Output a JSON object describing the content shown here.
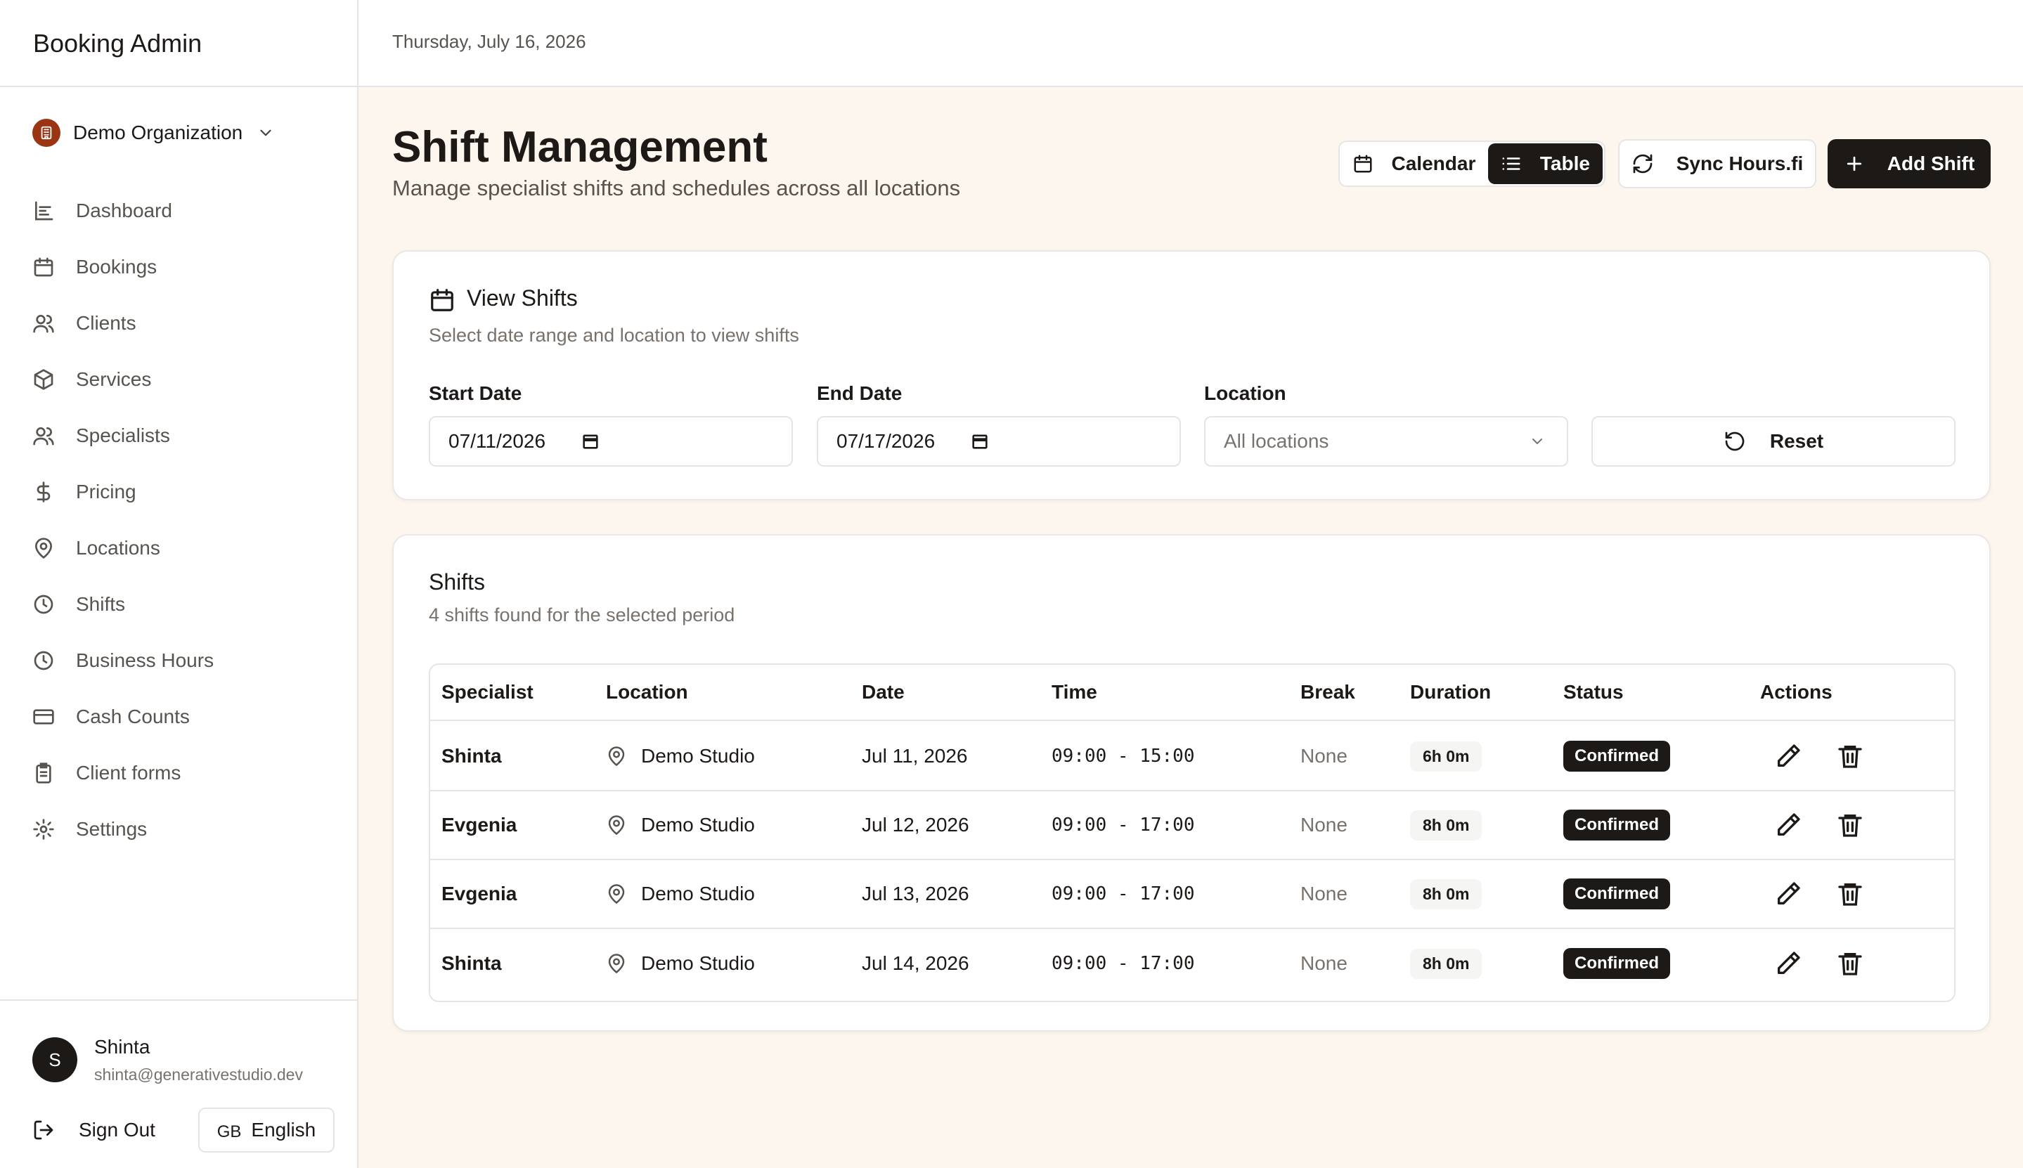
{
  "app": {
    "title": "Booking Admin"
  },
  "org": {
    "name": "Demo Organization"
  },
  "nav": [
    {
      "label": "Dashboard",
      "icon": "chart-icon"
    },
    {
      "label": "Bookings",
      "icon": "calendar-icon"
    },
    {
      "label": "Clients",
      "icon": "users-icon"
    },
    {
      "label": "Services",
      "icon": "package-icon"
    },
    {
      "label": "Specialists",
      "icon": "users-icon"
    },
    {
      "label": "Pricing",
      "icon": "dollar-icon"
    },
    {
      "label": "Locations",
      "icon": "map-pin-icon"
    },
    {
      "label": "Shifts",
      "icon": "clock-icon"
    },
    {
      "label": "Business Hours",
      "icon": "clock-icon"
    },
    {
      "label": "Cash Counts",
      "icon": "credit-card-icon"
    },
    {
      "label": "Client forms",
      "icon": "clipboard-icon"
    },
    {
      "label": "Settings",
      "icon": "gear-icon"
    }
  ],
  "user": {
    "initial": "S",
    "name": "Shinta",
    "email": "shinta@generativestudio.dev"
  },
  "footer": {
    "sign_out": "Sign Out",
    "lang_flag": "GB",
    "lang_label": "English"
  },
  "topbar": {
    "date": "Thursday, July 16, 2026"
  },
  "header": {
    "title": "Shift Management",
    "subtitle": "Manage specialist shifts and schedules across all locations",
    "view_calendar": "Calendar",
    "view_table": "Table",
    "active_view": "Table",
    "sync_label": "Sync Hours.fi",
    "add_label": "Add Shift"
  },
  "filters": {
    "title": "View Shifts",
    "subtitle": "Select date range and location to view shifts",
    "start_label": "Start Date",
    "start_value": "07/11/2026",
    "end_label": "End Date",
    "end_value": "07/17/2026",
    "location_label": "Location",
    "location_value": "All locations",
    "reset_label": "Reset"
  },
  "shifts": {
    "title": "Shifts",
    "subtitle": "4 shifts found for the selected period",
    "columns": [
      "Specialist",
      "Location",
      "Date",
      "Time",
      "Break",
      "Duration",
      "Status",
      "Actions"
    ],
    "rows": [
      {
        "specialist": "Shinta",
        "location": "Demo Studio",
        "date": "Jul 11, 2026",
        "time": "09:00 - 15:00",
        "break": "None",
        "duration": "6h 0m",
        "status": "Confirmed"
      },
      {
        "specialist": "Evgenia",
        "location": "Demo Studio",
        "date": "Jul 12, 2026",
        "time": "09:00 - 17:00",
        "break": "None",
        "duration": "8h 0m",
        "status": "Confirmed"
      },
      {
        "specialist": "Evgenia",
        "location": "Demo Studio",
        "date": "Jul 13, 2026",
        "time": "09:00 - 17:00",
        "break": "None",
        "duration": "8h 0m",
        "status": "Confirmed"
      },
      {
        "specialist": "Shinta",
        "location": "Demo Studio",
        "date": "Jul 14, 2026",
        "time": "09:00 - 17:00",
        "break": "None",
        "duration": "8h 0m",
        "status": "Confirmed"
      }
    ]
  },
  "colors": {
    "accent": "#1c1917",
    "page_bg": "#fdf6ee",
    "org_badge": "#9a3412"
  }
}
